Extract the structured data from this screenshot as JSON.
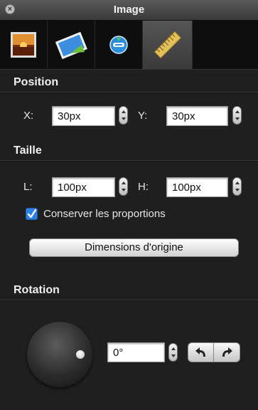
{
  "window": {
    "title": "Image"
  },
  "tabs": [
    {
      "name": "image"
    },
    {
      "name": "photo"
    },
    {
      "name": "web"
    },
    {
      "name": "ruler",
      "active": true
    }
  ],
  "position": {
    "title": "Position",
    "x_label": "X:",
    "x_value": "30px",
    "y_label": "Y:",
    "y_value": "30px"
  },
  "size": {
    "title": "Taille",
    "w_label": "L:",
    "w_value": "100px",
    "h_label": "H:",
    "h_value": "100px",
    "keep_ratio_label": "Conserver les proportions",
    "keep_ratio_checked": true,
    "original_button": "Dimensions d'origine"
  },
  "rotation": {
    "title": "Rotation",
    "angle_value": "0°"
  },
  "colors": {
    "background": "#1f1f1f",
    "checkbox": "#2d7fe6"
  }
}
